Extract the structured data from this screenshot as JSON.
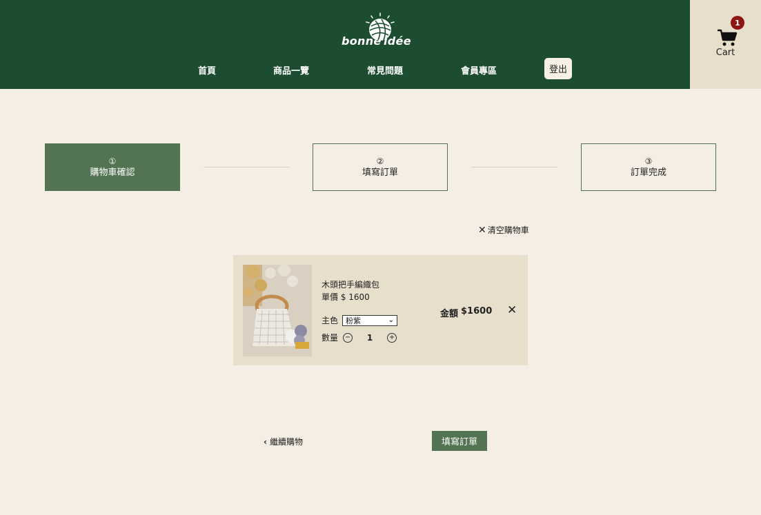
{
  "brand": {
    "left": "bonne",
    "right": "idée"
  },
  "nav": {
    "home": "首頁",
    "products": "商品一覽",
    "faq": "常見問題",
    "member": "會員專區",
    "logout": "登出"
  },
  "cart": {
    "label": "Cart",
    "count": "1"
  },
  "steps": [
    {
      "num": "①",
      "label": "購物車確認"
    },
    {
      "num": "②",
      "label": "填寫訂單"
    },
    {
      "num": "③",
      "label": "訂單完成"
    }
  ],
  "clear_cart": "清空購物車",
  "item": {
    "name": "木頭把手編織包",
    "unit_price": "單價 $ 1600",
    "color_label": "主色",
    "color_value": "粉紫",
    "qty_label": "數量",
    "qty": "1",
    "amount_label": "金額",
    "amount_value": "$1600"
  },
  "actions": {
    "continue": "繼續購物",
    "checkout": "填寫訂單"
  },
  "colors": {
    "header": "#1c4d30",
    "accent": "#527453",
    "background": "#f5eee4",
    "card": "#e7dfcc",
    "badge": "#8f1414"
  },
  "icons": [
    "yarn-ball-icon",
    "cart-icon",
    "close-icon",
    "chevron-down-icon",
    "minus-icon",
    "plus-icon",
    "chevron-left-icon"
  ]
}
